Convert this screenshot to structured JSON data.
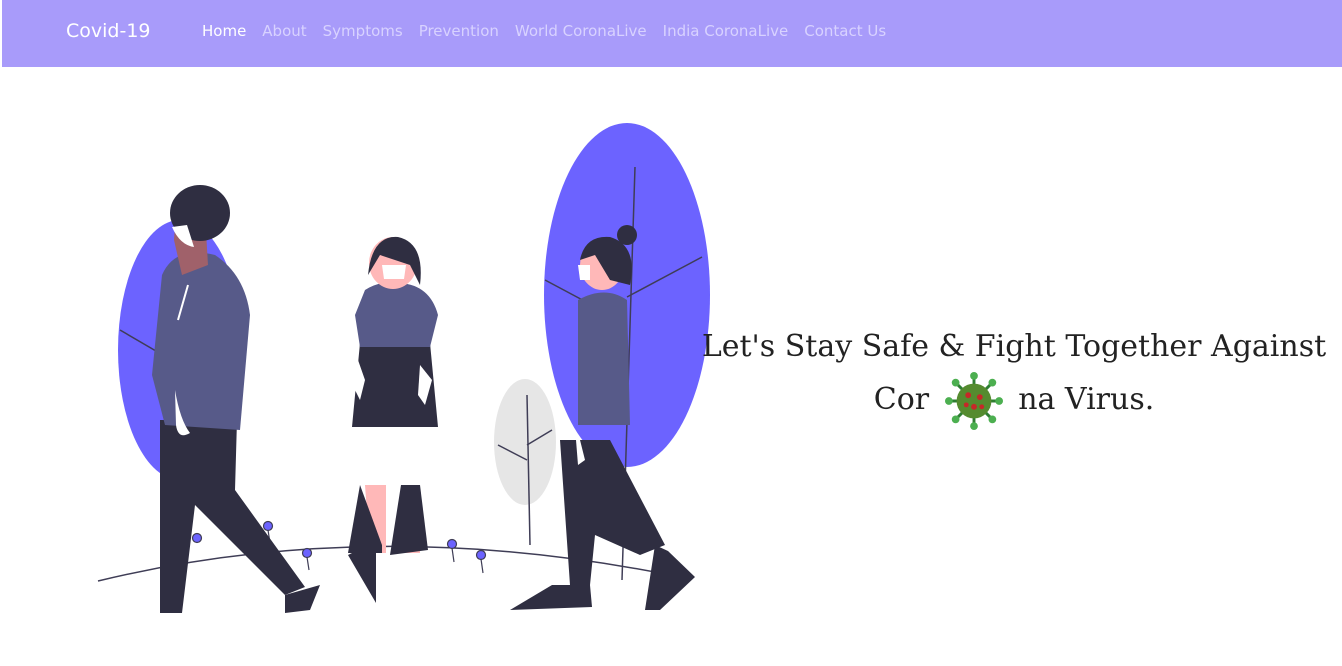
{
  "navbar": {
    "brand": "Covid-19",
    "links": [
      {
        "label": "Home",
        "active": true
      },
      {
        "label": "About",
        "active": false
      },
      {
        "label": "Symptoms",
        "active": false
      },
      {
        "label": "Prevention",
        "active": false
      },
      {
        "label": "World CoronaLive",
        "active": false
      },
      {
        "label": "India CoronaLive",
        "active": false
      },
      {
        "label": "Contact Us",
        "active": false
      }
    ]
  },
  "hero": {
    "line1": "Let's Stay Safe & Fight Together Against",
    "line2_start": "Cor",
    "line2_end": "na Virus.",
    "virus_icon": "virus-icon"
  },
  "colors": {
    "navbar_bg": "#a89bfa",
    "accent": "#6c63ff",
    "dark_figure": "#2f2e41",
    "shirt": "#575a89"
  }
}
